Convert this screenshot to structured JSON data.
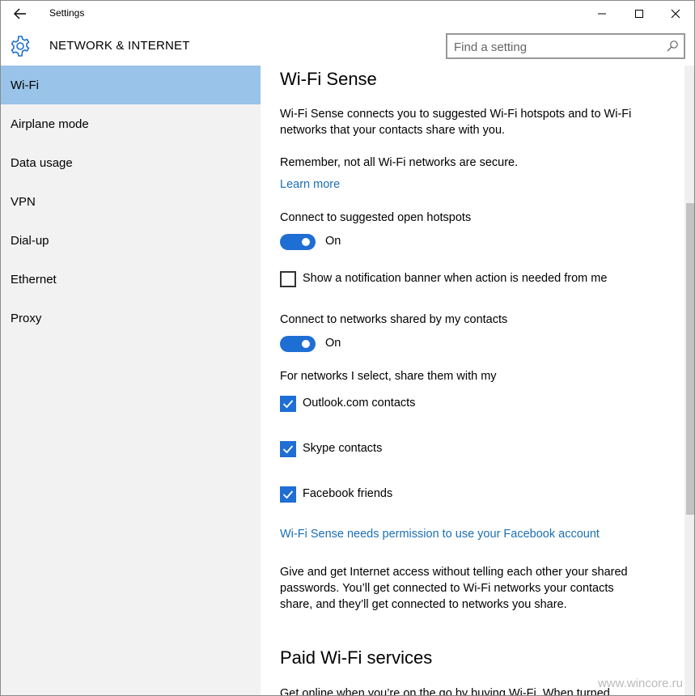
{
  "window": {
    "title": "Settings"
  },
  "header": {
    "section_title": "NETWORK & INTERNET",
    "search_placeholder": "Find a setting"
  },
  "sidebar": {
    "items": [
      {
        "label": "Wi-Fi",
        "active": true
      },
      {
        "label": "Airplane mode"
      },
      {
        "label": "Data usage"
      },
      {
        "label": "VPN"
      },
      {
        "label": "Dial-up"
      },
      {
        "label": "Ethernet"
      },
      {
        "label": "Proxy"
      }
    ]
  },
  "content": {
    "wifi_sense_title": "Wi-Fi Sense",
    "intro_line1": "Wi-Fi Sense connects you to suggested Wi-Fi hotspots and to Wi-Fi",
    "intro_line2": "networks that your contacts share with you.",
    "remember": "Remember, not all Wi-Fi networks are secure.",
    "learn_more": "Learn more",
    "open_hotspots_label": "Connect to suggested open hotspots",
    "open_hotspots_state": "On",
    "notification_banner_label": "Show a notification banner when action is needed from me",
    "shared_networks_label": "Connect to networks shared by my contacts",
    "shared_networks_state": "On",
    "share_with_label": "For networks I select, share them with my",
    "share_options": [
      {
        "label": "Outlook.com contacts",
        "checked": true
      },
      {
        "label": "Skype contacts",
        "checked": true
      },
      {
        "label": "Facebook friends",
        "checked": true
      }
    ],
    "facebook_permission_link": "Wi-Fi Sense needs permission to use your Facebook account",
    "give_get_line1": "Give and get Internet access without telling each other your shared",
    "give_get_line2": "passwords. You’ll get connected to Wi-Fi networks your contacts",
    "give_get_line3": "share, and they’ll get connected to networks you share.",
    "paid_title": "Paid Wi-Fi services",
    "paid_intro": "Get online when you’re on the go by buying Wi-Fi. When turned"
  },
  "watermark": "www.wincore.ru",
  "colors": {
    "accent": "#1e6ed4",
    "sidebar_active": "#99c3e8",
    "link": "#1a6fb4",
    "sidebar_bg": "#f2f2f2"
  }
}
